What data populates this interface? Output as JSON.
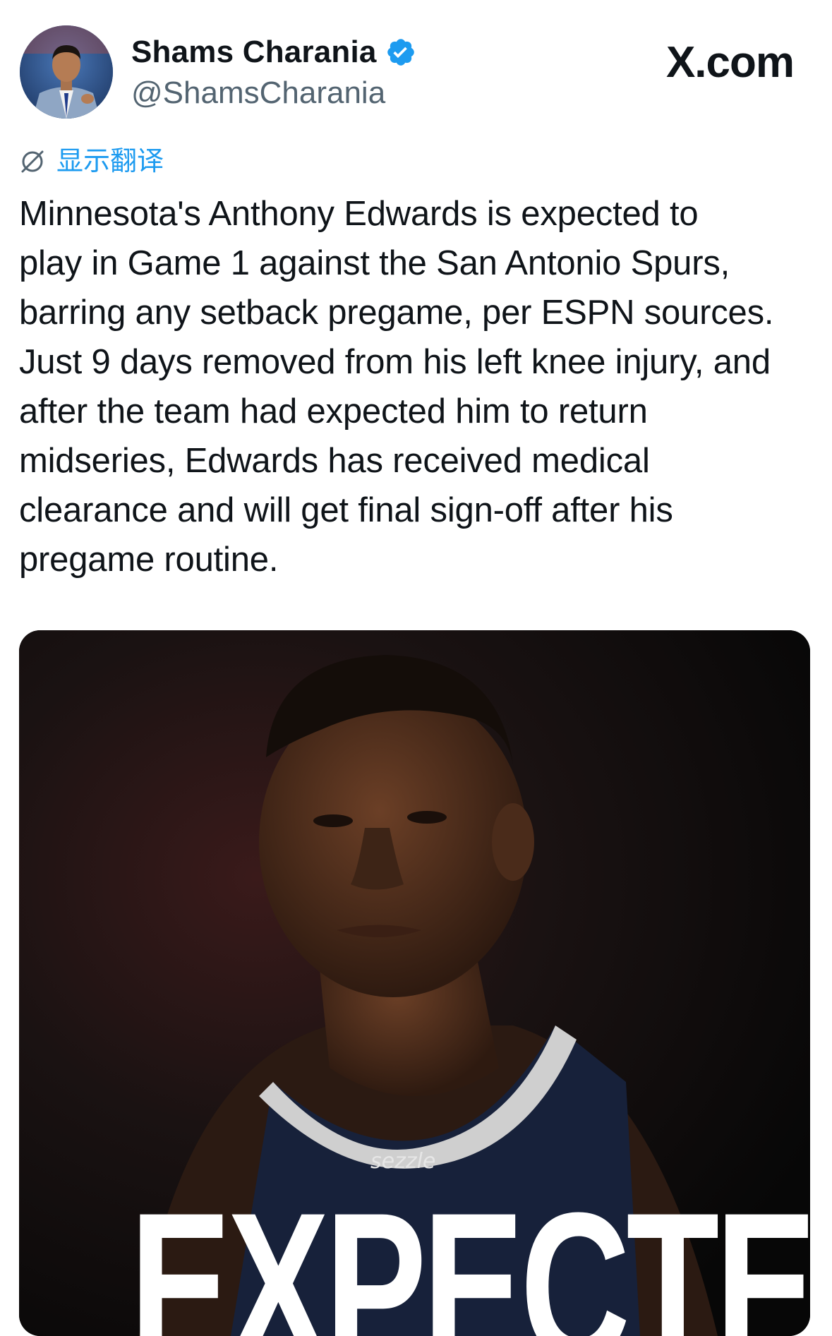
{
  "author": {
    "display_name": "Shams Charania",
    "handle": "@ShamsCharania",
    "verified": true,
    "verified_color": "#1d9bf0"
  },
  "brand": {
    "label": "X.com"
  },
  "translate": {
    "icon": "translate-globe-icon",
    "label": "显示翻译",
    "color": "#1d9bf0"
  },
  "tweet": {
    "text": "Minnesota's Anthony Edwards is expected to\nplay in Game 1 against the San Antonio Spurs,\nbarring any setback pregame, per ESPN sources.\nJust 9 days removed from his left knee injury, and\nafter the team had expected him to return\nmidseries, Edwards has received medical\nclearance and will get final sign-off after his\npregame routine."
  },
  "media": {
    "overlay_text": "EXPECTED",
    "jersey_sponsor": "sezzle"
  }
}
